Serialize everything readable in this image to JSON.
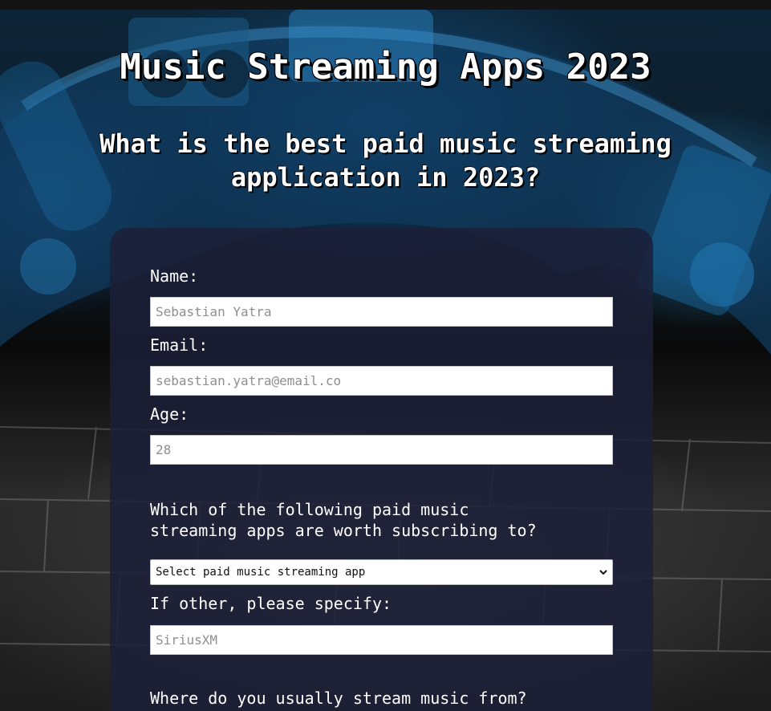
{
  "page": {
    "title": "Music Streaming Apps 2023",
    "subtitle": "What is the best paid music streaming application in 2023?"
  },
  "form": {
    "name": {
      "label": "Name:",
      "placeholder": "Sebastian Yatra"
    },
    "email": {
      "label": "Email:",
      "placeholder": "sebastian.yatra@email.co"
    },
    "age": {
      "label": "Age:",
      "placeholder": "28"
    },
    "apps_question": {
      "line1": "Which of the following paid music",
      "line2": "streaming apps are worth subscribing to?"
    },
    "apps_select": {
      "selected": "Select paid music streaming app",
      "icon": "chevron-down-icon"
    },
    "other": {
      "label": "If other, please specify:",
      "placeholder": "SiriusXM"
    },
    "stream_question": "Where do you usually stream music from?"
  },
  "colors": {
    "card_background": "#1c1f38",
    "text": "#ffffff",
    "input_background": "#ffffff",
    "placeholder": "#8f8f8f"
  }
}
